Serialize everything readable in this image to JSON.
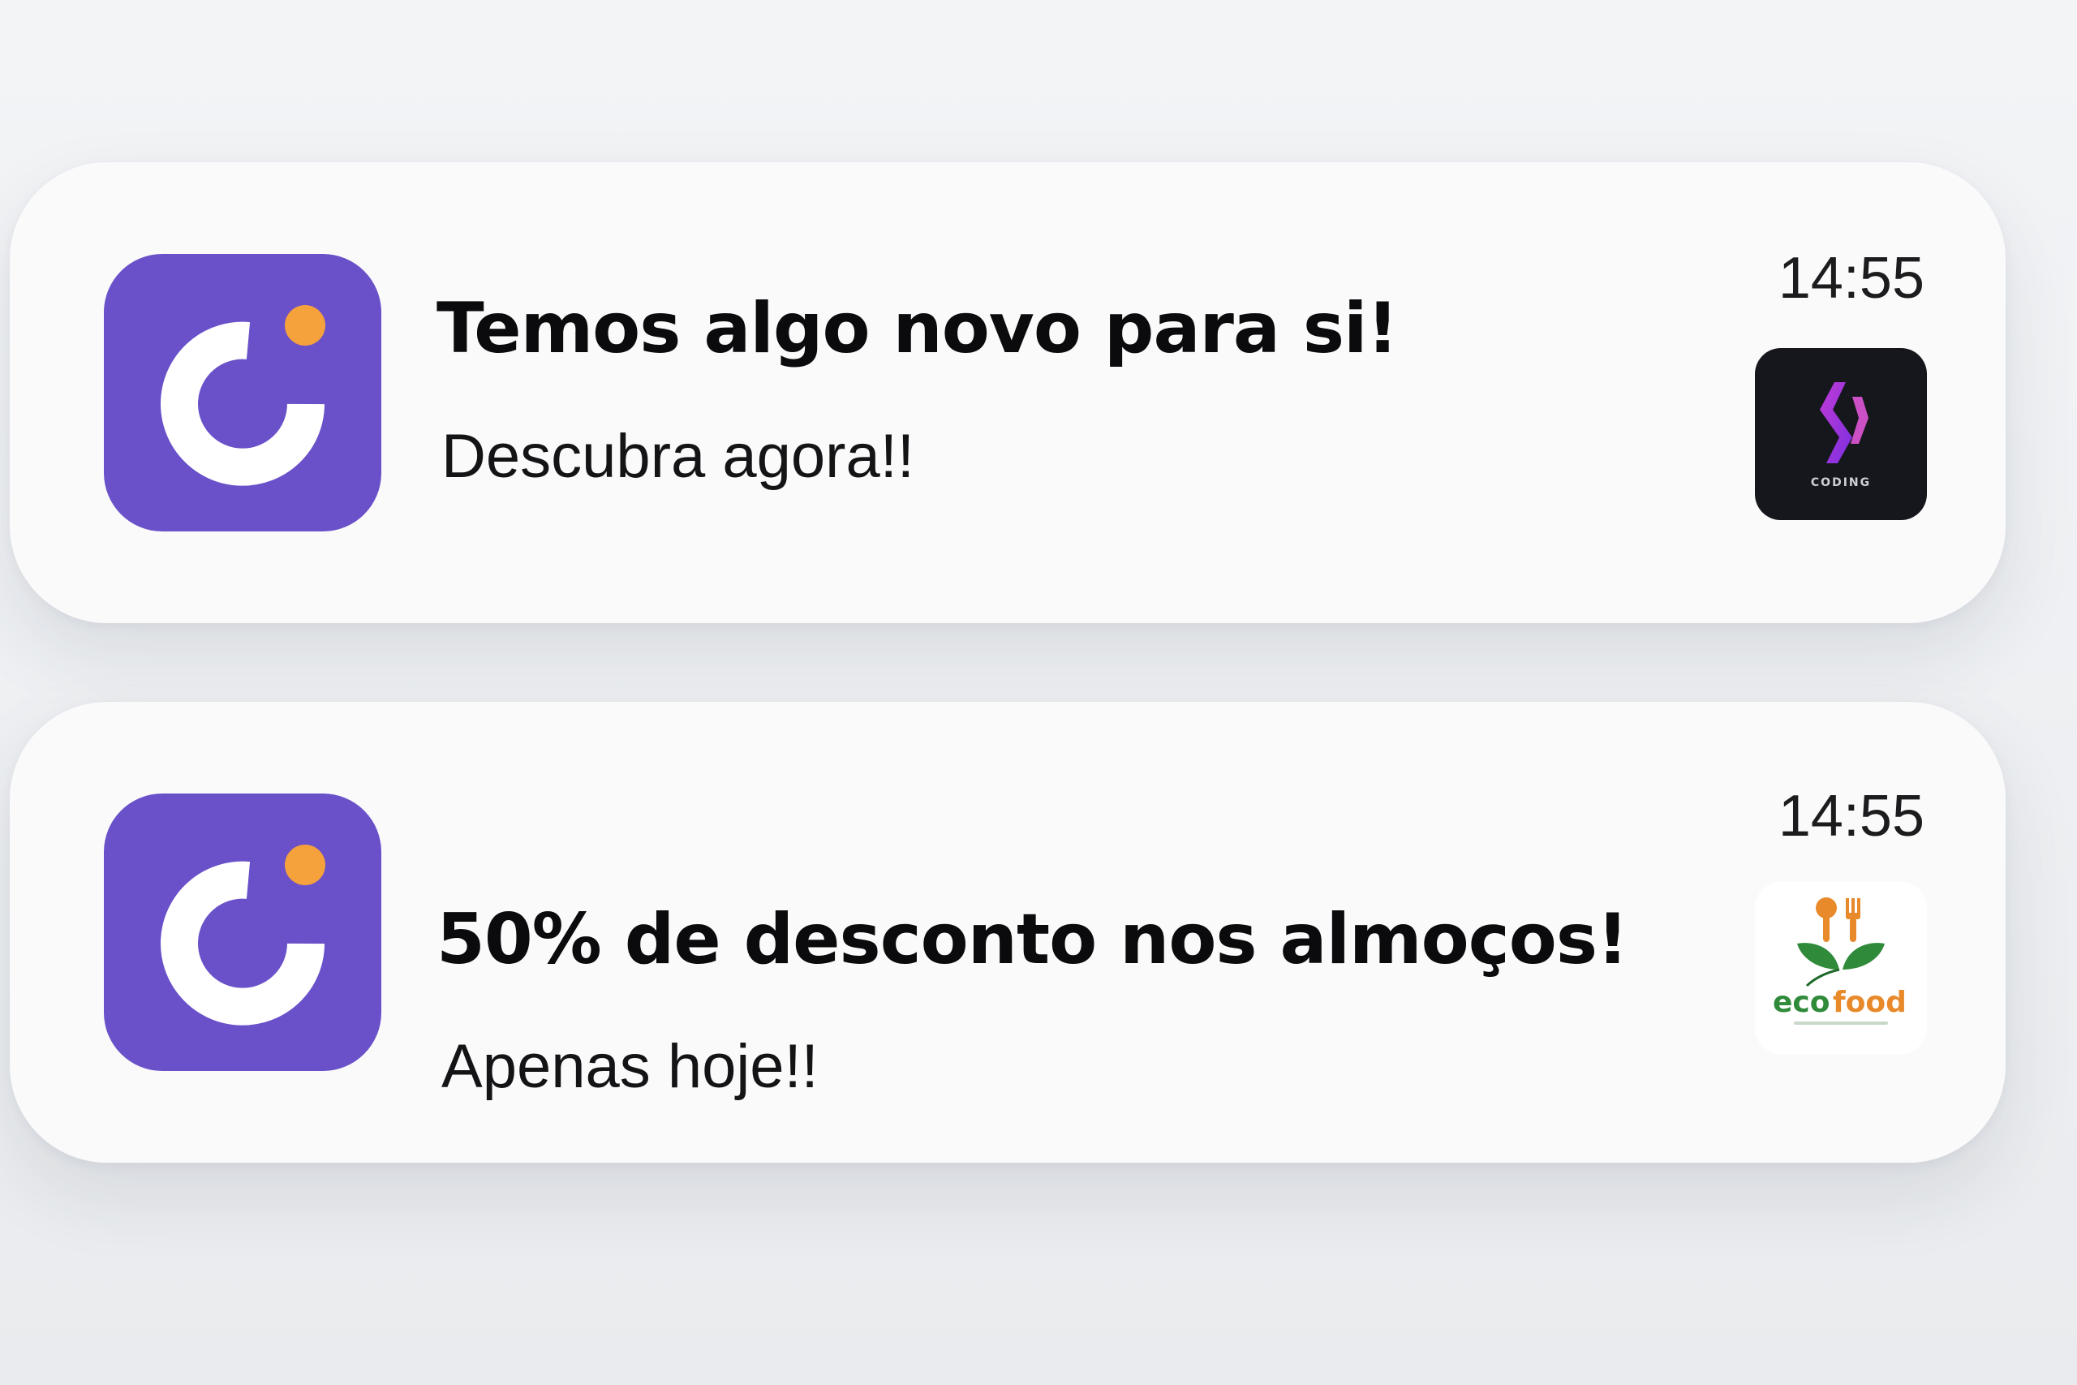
{
  "notifications": [
    {
      "app_icon": "app-logo-icon",
      "title": "Temos algo novo para si!",
      "body": "Descubra agora!!",
      "time": "14:55",
      "thumbnail": {
        "icon": "coding-logo-icon",
        "caption": "CODING"
      }
    },
    {
      "app_icon": "app-logo-icon",
      "title": "50% de desconto nos almoços!",
      "body": "Apenas hoje!!",
      "time": "14:55",
      "thumbnail": {
        "icon": "ecofood-logo-icon",
        "caption_eco": "eco",
        "caption_food": "food"
      }
    }
  ],
  "colors": {
    "app_icon_bg": "#6a51c9",
    "app_icon_dot": "#f5a13c",
    "eco_green": "#2f8a3a",
    "food_orange": "#e8892a"
  }
}
